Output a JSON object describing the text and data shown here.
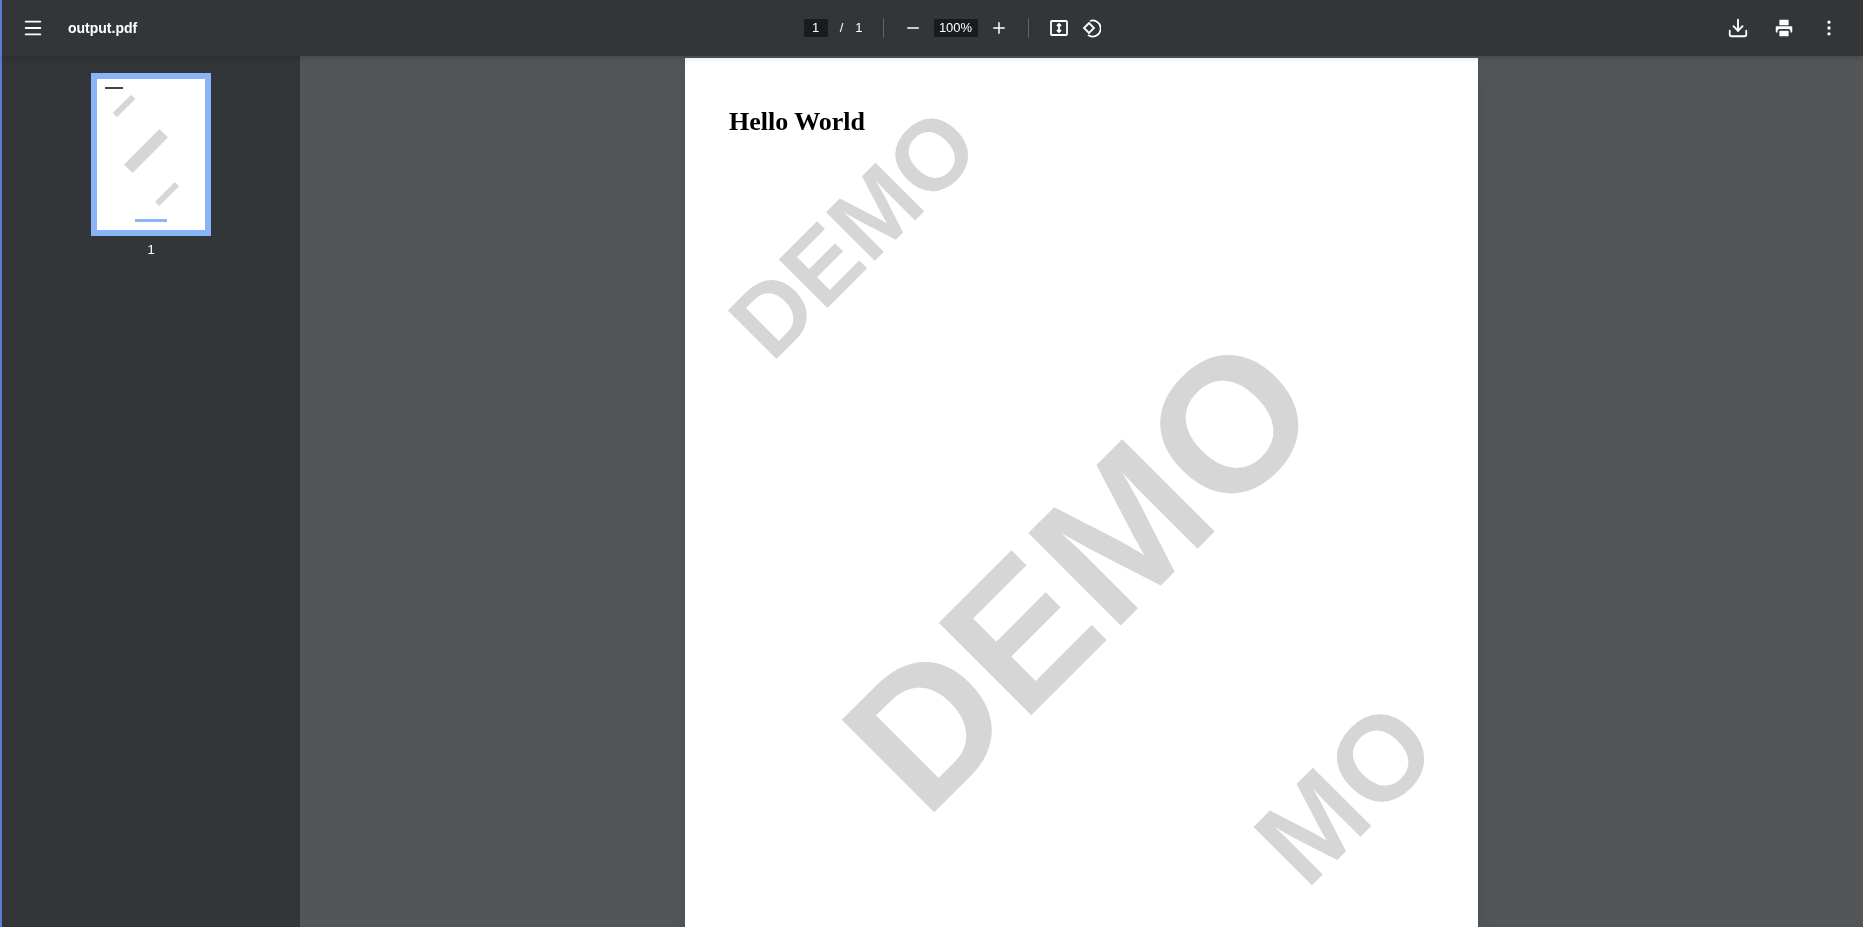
{
  "toolbar": {
    "file_name": "output.pdf",
    "page_number": "1",
    "page_separator": "/",
    "page_count": "1",
    "zoom": "100%"
  },
  "sidebar": {
    "thumbnails": [
      {
        "label": "1",
        "selected": true
      }
    ]
  },
  "page": {
    "heading": "Hello World",
    "watermarks": [
      "DEMO",
      "DEMO",
      "MO"
    ]
  }
}
